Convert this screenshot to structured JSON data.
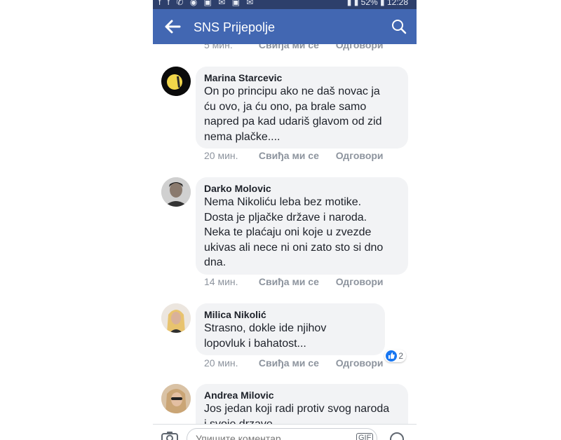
{
  "app": {
    "status": {
      "left_icons": "f f ✆ ◉ ▣ ✉ ▣ ✉",
      "battery": "52%",
      "time": "12:28"
    },
    "title": "SNS Prijepolje",
    "icons": {
      "back": "back-arrow-icon",
      "search": "search-icon"
    }
  },
  "actions": {
    "like": "Свиђа ми се",
    "reply": "Одговори"
  },
  "previous": {
    "time": "5 мин."
  },
  "comments": [
    {
      "author": "Marina Starcevic",
      "lines": [
        "On po principu ako ne daš novac ja",
        "ću ovo, ja ću ono, pa brale samo",
        "napred pa kad udariš glavom od zid",
        "nema plačke...."
      ],
      "time": "20 мин."
    },
    {
      "author": "Darko Molovic",
      "lines": [
        "Nema Nikoliću leba bez motike.",
        "Dosta je pljačke države i naroda.",
        "Neka te plaćaju oni koje u zvezde",
        "ukivas ali nece ni oni zato sto si dno",
        "dna."
      ],
      "time": "14 мин."
    },
    {
      "author": "Milica Nikolić",
      "lines": [
        "Strasno, dokle ide njihov",
        "lopovluk i bahatost..."
      ],
      "time": "20 мин.",
      "reactions": "2"
    },
    {
      "author": "Andrea Milovic",
      "lines": [
        "Jos jedan koji radi protiv svog naroda",
        "i svoje drzave..."
      ]
    }
  ],
  "composer": {
    "placeholder": "Упишите коментар...",
    "gif": "GIF"
  }
}
